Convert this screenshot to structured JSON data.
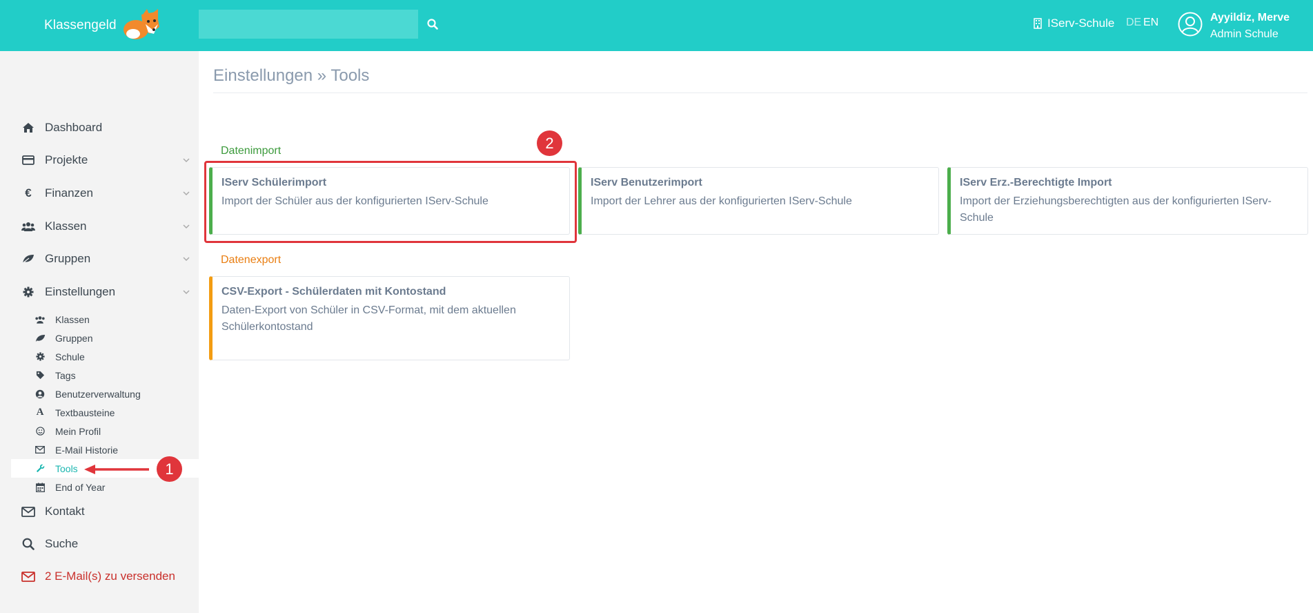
{
  "header": {
    "brand": "Klassengeld",
    "search_placeholder": "",
    "school": "IServ-Schule",
    "lang_de": "DE",
    "lang_en": "EN",
    "user_name": "Ayyildiz, Merve",
    "user_role": "Admin Schule"
  },
  "sidebar": {
    "items": [
      {
        "label": "Dashboard",
        "icon": "home-icon"
      },
      {
        "label": "Projekte",
        "icon": "credit-card-icon"
      },
      {
        "label": "Finanzen",
        "icon": "euro-icon"
      },
      {
        "label": "Klassen",
        "icon": "users-icon"
      },
      {
        "label": "Gruppen",
        "icon": "leaf-icon"
      },
      {
        "label": "Einstellungen",
        "icon": "gear-icon"
      }
    ],
    "sub_items": [
      {
        "label": "Klassen",
        "icon": "users-icon"
      },
      {
        "label": "Gruppen",
        "icon": "leaf-icon"
      },
      {
        "label": "Schule",
        "icon": "gear-icon"
      },
      {
        "label": "Tags",
        "icon": "tag-icon"
      },
      {
        "label": "Benutzerverwaltung",
        "icon": "user-circle-icon"
      },
      {
        "label": "Textbausteine",
        "icon": "font-icon"
      },
      {
        "label": "Mein Profil",
        "icon": "smile-icon"
      },
      {
        "label": "E-Mail Historie",
        "icon": "envelope-icon"
      },
      {
        "label": "Tools",
        "icon": "wrench-icon"
      },
      {
        "label": "End of Year",
        "icon": "calendar-icon"
      }
    ],
    "bottom_items": [
      {
        "label": "Kontakt",
        "icon": "envelope-icon"
      },
      {
        "label": "Suche",
        "icon": "search-icon"
      },
      {
        "label": "2 E-Mail(s) zu versenden",
        "icon": "envelope-icon"
      }
    ]
  },
  "main": {
    "breadcrumb": "Einstellungen » Tools",
    "import_title": "Datenimport",
    "export_title": "Datenexport",
    "import_cards": [
      {
        "title": "IServ Schülerimport",
        "desc": "Import der Schüler aus der konfigurierten IServ-Schule"
      },
      {
        "title": "IServ Benutzerimport",
        "desc": "Import der Lehrer aus der konfigurierten IServ-Schule"
      },
      {
        "title": "IServ Erz.-Berechtigte Import",
        "desc": "Import der Erziehungsberechtigten aus der konfigurierten IServ-Schule"
      }
    ],
    "export_cards": [
      {
        "title": "CSV-Export - Schülerdaten mit Kontostand",
        "desc": "Daten-Export von Schüler in CSV-Format, mit dem aktuellen Schülerkontostand"
      }
    ]
  },
  "annotations": {
    "badge_1": "1",
    "badge_2": "2",
    "color": "#e0353b"
  },
  "colors": {
    "brand": "#22cdc8",
    "active": "#1ab6b0"
  }
}
